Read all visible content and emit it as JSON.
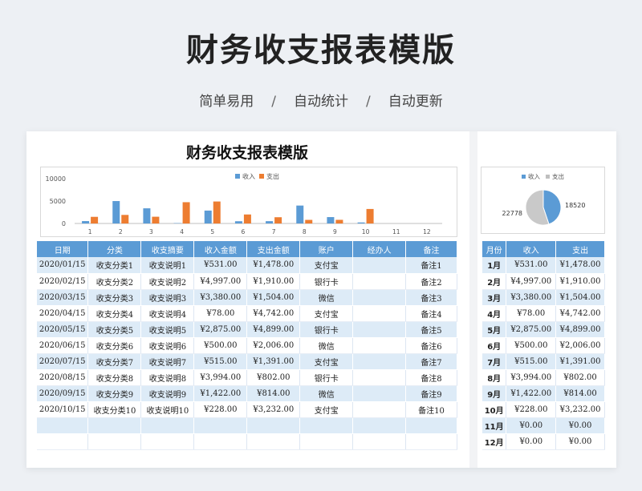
{
  "hero": {
    "title": "财务收支报表模版",
    "features": [
      "简单易用",
      "自动统计",
      "自动更新"
    ],
    "separator": "/"
  },
  "sheet": {
    "title": "财务收支报表模版"
  },
  "table": {
    "headers": [
      "日期",
      "分类",
      "收支摘要",
      "收入金额",
      "支出金额",
      "账户",
      "经办人",
      "备注"
    ],
    "rows": [
      [
        "2020/01/15",
        "收支分类1",
        "收支说明1",
        "¥531.00",
        "¥1,478.00",
        "支付宝",
        "",
        "备注1"
      ],
      [
        "2020/02/15",
        "收支分类2",
        "收支说明2",
        "¥4,997.00",
        "¥1,910.00",
        "银行卡",
        "",
        "备注2"
      ],
      [
        "2020/03/15",
        "收支分类3",
        "收支说明3",
        "¥3,380.00",
        "¥1,504.00",
        "微信",
        "",
        "备注3"
      ],
      [
        "2020/04/15",
        "收支分类4",
        "收支说明4",
        "¥78.00",
        "¥4,742.00",
        "支付宝",
        "",
        "备注4"
      ],
      [
        "2020/05/15",
        "收支分类5",
        "收支说明5",
        "¥2,875.00",
        "¥4,899.00",
        "银行卡",
        "",
        "备注5"
      ],
      [
        "2020/06/15",
        "收支分类6",
        "收支说明6",
        "¥500.00",
        "¥2,006.00",
        "微信",
        "",
        "备注6"
      ],
      [
        "2020/07/15",
        "收支分类7",
        "收支说明7",
        "¥515.00",
        "¥1,391.00",
        "支付宝",
        "",
        "备注7"
      ],
      [
        "2020/08/15",
        "收支分类8",
        "收支说明8",
        "¥3,994.00",
        "¥802.00",
        "银行卡",
        "",
        "备注8"
      ],
      [
        "2020/09/15",
        "收支分类9",
        "收支说明9",
        "¥1,422.00",
        "¥814.00",
        "微信",
        "",
        "备注9"
      ],
      [
        "2020/10/15",
        "收支分类10",
        "收支说明10",
        "¥228.00",
        "¥3,232.00",
        "支付宝",
        "",
        "备注10"
      ]
    ]
  },
  "summary": {
    "headers": [
      "月份",
      "收入",
      "支出"
    ],
    "rows": [
      [
        "1月",
        "¥531.00",
        "¥1,478.00"
      ],
      [
        "2月",
        "¥4,997.00",
        "¥1,910.00"
      ],
      [
        "3月",
        "¥3,380.00",
        "¥1,504.00"
      ],
      [
        "4月",
        "¥78.00",
        "¥4,742.00"
      ],
      [
        "5月",
        "¥2,875.00",
        "¥4,899.00"
      ],
      [
        "6月",
        "¥500.00",
        "¥2,006.00"
      ],
      [
        "7月",
        "¥515.00",
        "¥1,391.00"
      ],
      [
        "8月",
        "¥3,994.00",
        "¥802.00"
      ],
      [
        "9月",
        "¥1,422.00",
        "¥814.00"
      ],
      [
        "10月",
        "¥228.00",
        "¥3,232.00"
      ],
      [
        "11月",
        "¥0.00",
        "¥0.00"
      ],
      [
        "12月",
        "¥0.00",
        "¥0.00"
      ]
    ]
  },
  "colors": {
    "income": "#5b9bd5",
    "expense": "#ed7d31",
    "header": "#5b9bd5",
    "stripe": "#ddebf7"
  },
  "chart_data": [
    {
      "type": "bar",
      "categories": [
        "1",
        "2",
        "3",
        "4",
        "5",
        "6",
        "7",
        "8",
        "9",
        "10",
        "11",
        "12"
      ],
      "series": [
        {
          "name": "收入",
          "values": [
            531,
            4997,
            3380,
            78,
            2875,
            500,
            515,
            3994,
            1422,
            228,
            0,
            0
          ]
        },
        {
          "name": "支出",
          "values": [
            1478,
            1910,
            1504,
            4742,
            4899,
            2006,
            1391,
            802,
            814,
            3232,
            0,
            0
          ]
        }
      ],
      "yticks": [
        "0",
        "5000",
        "10000"
      ],
      "ylim": [
        0,
        10000
      ],
      "legend": "top-center",
      "grid": false
    },
    {
      "type": "pie",
      "categories": [
        "收入",
        "支出"
      ],
      "values": [
        18520,
        22778
      ],
      "labels": [
        "18520",
        "22778"
      ],
      "legend": "top-center"
    }
  ]
}
